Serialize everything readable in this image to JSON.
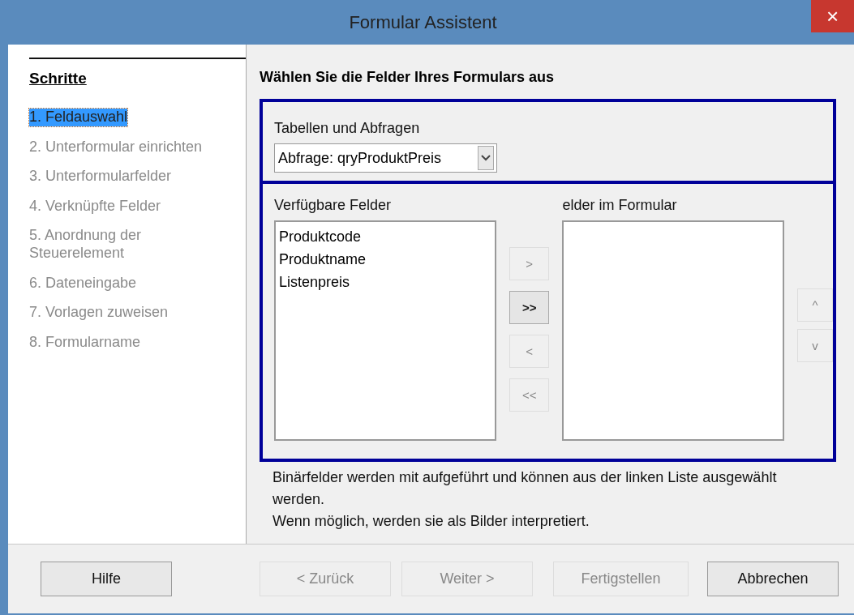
{
  "window": {
    "title": "Formular Assistent",
    "close": "×"
  },
  "sidebar": {
    "heading": "Schritte",
    "steps": [
      {
        "label": "1. Feldauswahl",
        "selected": true,
        "disabled": false
      },
      {
        "label": "2. Unterformular einrichten",
        "selected": false,
        "disabled": true
      },
      {
        "label": "3. Unterformularfelder",
        "selected": false,
        "disabled": true
      },
      {
        "label": "4. Verknüpfte Felder",
        "selected": false,
        "disabled": true
      },
      {
        "label": "5. Anordnung der Steuerelement",
        "selected": false,
        "disabled": true
      },
      {
        "label": "6. Dateneingabe",
        "selected": false,
        "disabled": true
      },
      {
        "label": "7. Vorlagen zuweisen",
        "selected": false,
        "disabled": true
      },
      {
        "label": "8. Formularname",
        "selected": false,
        "disabled": true
      }
    ]
  },
  "heading": "Wählen Sie die Felder Ihres Formulars aus",
  "source": {
    "label": "Tabellen und Abfragen",
    "value": "Abfrage: qryProduktPreis"
  },
  "available": {
    "label": "Verfügbare Felder",
    "items": [
      "Produktcode",
      "Produktname",
      "Listenpreis"
    ]
  },
  "move_buttons": [
    {
      "label": ">",
      "disabled": true
    },
    {
      "label": ">>",
      "disabled": false
    },
    {
      "label": "<",
      "disabled": true
    },
    {
      "label": "<<",
      "disabled": true
    }
  ],
  "selected_fields": {
    "label": "elder im Formular"
  },
  "order_buttons": [
    {
      "label": "^",
      "disabled": true
    },
    {
      "label": "v",
      "disabled": true
    }
  ],
  "note": [
    "Binärfelder werden mit aufgeführt und können aus der linken Liste ausgewählt werden.",
    "Wenn möglich, werden sie als Bilder interpretiert."
  ],
  "footer_buttons": [
    {
      "label": "Hilfe",
      "disabled": false
    },
    {
      "label": "< Zurück",
      "disabled": true
    },
    {
      "label": "Weiter >",
      "disabled": true
    },
    {
      "label": "Fertigstellen",
      "disabled": true
    },
    {
      "label": "Abbrechen",
      "disabled": false
    }
  ]
}
